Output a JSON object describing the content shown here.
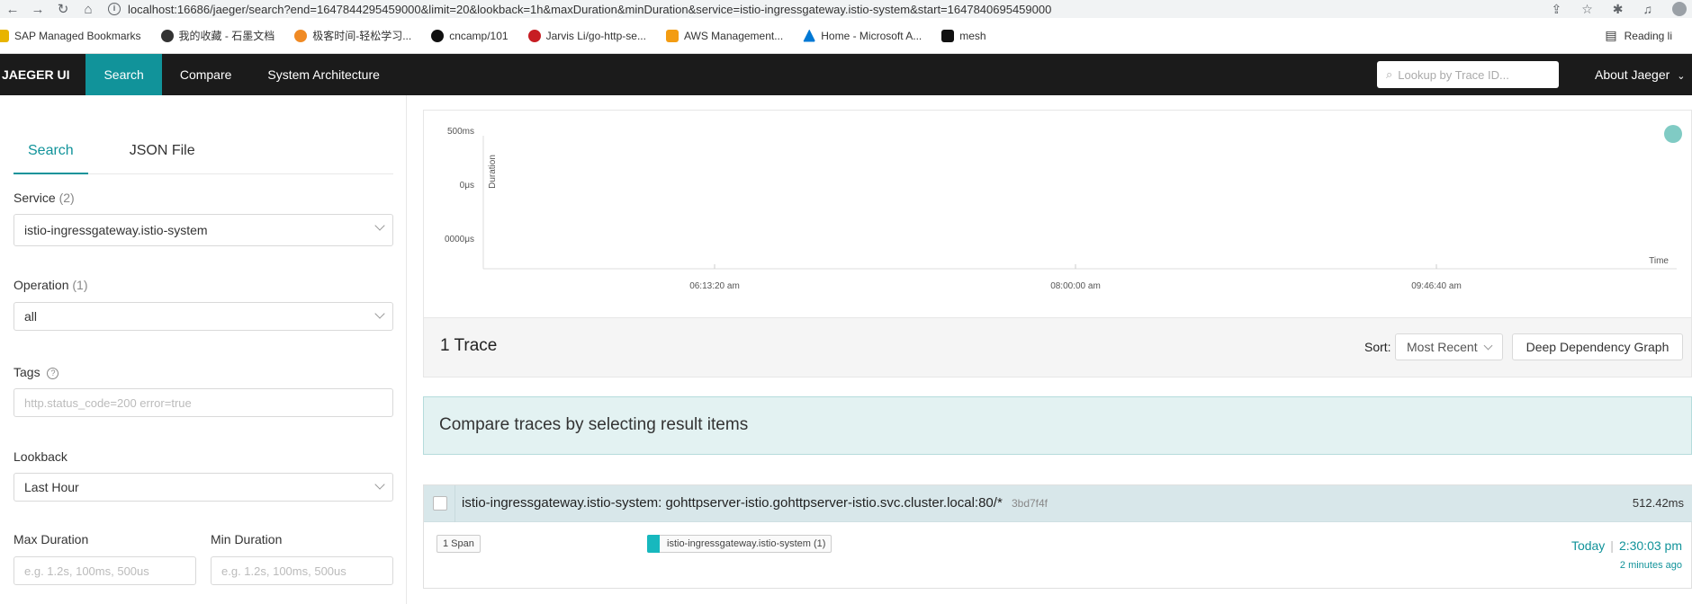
{
  "browser": {
    "url": "localhost:16686/jaeger/search?end=1647844295459000&limit=20&lookback=1h&maxDuration&minDuration&service=istio-ingressgateway.istio-system&start=1647840695459000",
    "bookmarks": [
      {
        "label": "SAP Managed Bookmarks",
        "icon": "folder-icon",
        "color": "#e8b400"
      },
      {
        "label": "我的收藏 - 石墨文档",
        "icon": "shimo-icon",
        "color": "#333333"
      },
      {
        "label": "极客时间-轻松学习...",
        "icon": "geektime-icon",
        "color": "#f08a24"
      },
      {
        "label": "cncamp/101",
        "icon": "github-icon",
        "color": "#111111"
      },
      {
        "label": "Jarvis Li/go-http-se...",
        "icon": "gitee-icon",
        "color": "#c71d23"
      },
      {
        "label": "AWS Management...",
        "icon": "aws-icon",
        "color": "#f39c12"
      },
      {
        "label": "Home - Microsoft A...",
        "icon": "azure-icon",
        "color": "#0078d4"
      },
      {
        "label": "mesh",
        "icon": "notion-icon",
        "color": "#111111"
      }
    ],
    "reading_list": "Reading li"
  },
  "nav": {
    "brand": "JAEGER UI",
    "items": [
      "Search",
      "Compare",
      "System Architecture"
    ],
    "lookup_placeholder": "Lookup by Trace ID...",
    "about": "About Jaeger"
  },
  "search_form": {
    "tabs": [
      "Search",
      "JSON File"
    ],
    "service_label": "Service",
    "service_count": "(2)",
    "service_value": "istio-ingressgateway.istio-system",
    "operation_label": "Operation",
    "operation_count": "(1)",
    "operation_value": "all",
    "tags_label": "Tags",
    "tags_placeholder": "http.status_code=200 error=true",
    "lookback_label": "Lookback",
    "lookback_value": "Last Hour",
    "max_duration_label": "Max Duration",
    "min_duration_label": "Min Duration",
    "duration_placeholder": "e.g. 1.2s, 100ms, 500us"
  },
  "chart_data": {
    "type": "scatter",
    "ylabel": "Duration",
    "xlabel": "Time",
    "y_ticks": [
      "500ms",
      "0μs",
      "0000μs"
    ],
    "x_ticks": [
      "06:13:20 am",
      "08:00:00 am",
      "09:46:40 am"
    ],
    "points": [
      {
        "x": "2:30:03 pm",
        "y": "512.42ms"
      }
    ],
    "point_color": "#80cbc4"
  },
  "results": {
    "count_label": "1 Trace",
    "sort_label": "Sort:",
    "sort_value": "Most Recent",
    "ddg_button": "Deep Dependency Graph",
    "compare_text": "Compare traces by selecting result items"
  },
  "trace": {
    "title": "istio-ingressgateway.istio-system: gohttpserver-istio.gohttpserver-istio.svc.cluster.local:80/*",
    "trace_id": "3bd7f4f",
    "duration": "512.42ms",
    "span_count": "1 Span",
    "service_badge": "istio-ingressgateway.istio-system (1)",
    "service_color": "#17b8be",
    "date": "Today",
    "time": "2:30:03 pm",
    "ago": "2 minutes ago"
  }
}
